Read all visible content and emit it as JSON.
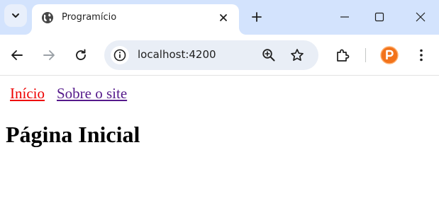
{
  "browser": {
    "tab": {
      "title": "Programício",
      "favicon": "globe-icon"
    },
    "address_bar": {
      "url": "localhost:4200"
    },
    "profile": {
      "initial": "P",
      "color": "#f2731b"
    },
    "colors": {
      "tabstrip": "#d3e3fd",
      "omnibox": "#e9eef6"
    }
  },
  "page": {
    "nav": {
      "home_label": "Início",
      "about_label": "Sobre o site"
    },
    "heading": "Página Inicial",
    "colors": {
      "active_link": "#ee0000",
      "visited_link": "#551a8b"
    }
  }
}
